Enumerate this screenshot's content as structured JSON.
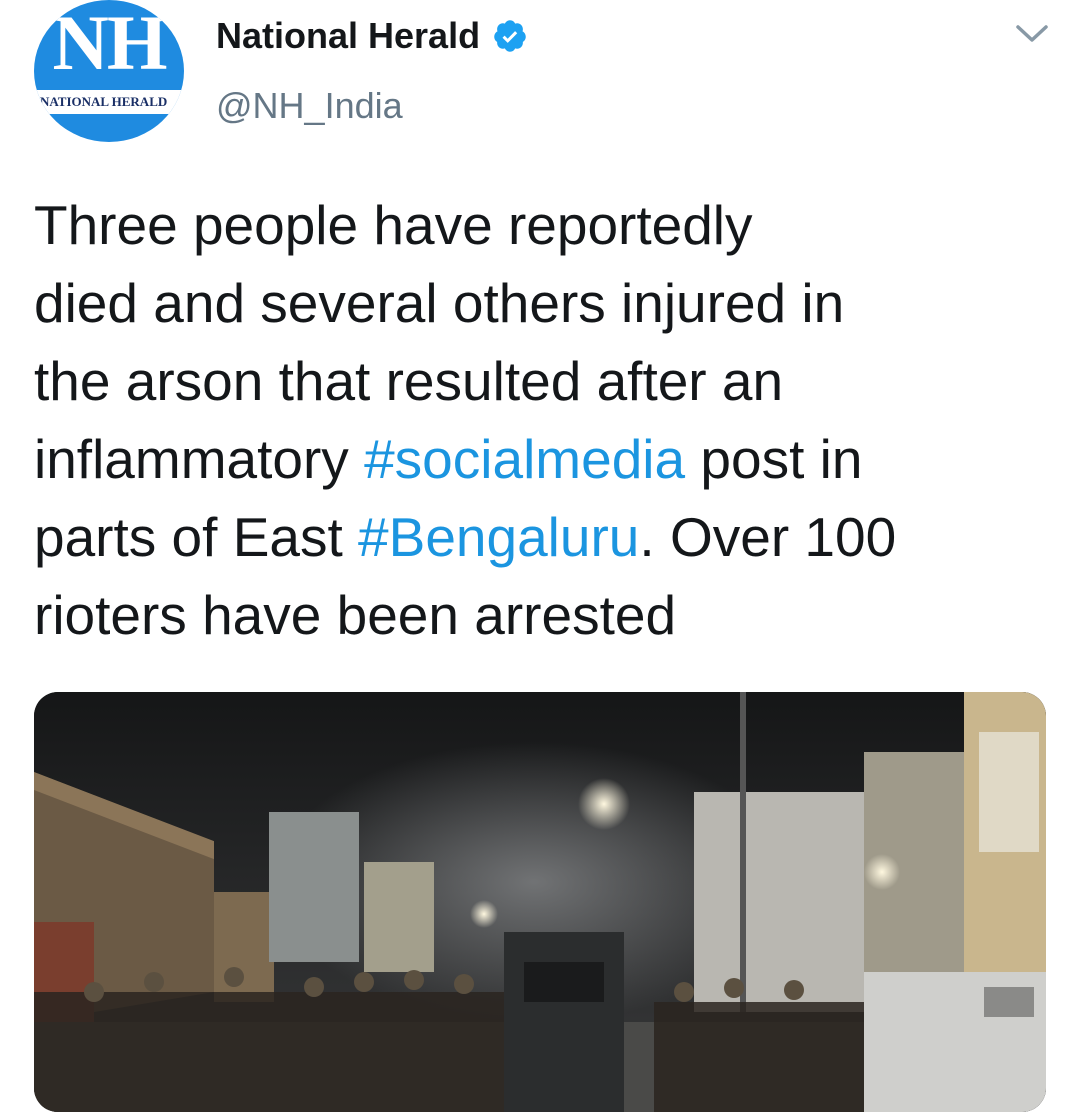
{
  "account": {
    "display_name": "National Herald",
    "handle": "@NH_India",
    "avatar_letters": "NH",
    "avatar_strip_text": "NATIONAL HERALD"
  },
  "tweet": {
    "lines": [
      [
        {
          "t": "Three people have reportedly"
        }
      ],
      [
        {
          "t": "died and several others injured in"
        }
      ],
      [
        {
          "t": "the arson that resulted after an"
        }
      ],
      [
        {
          "t": "inflammatory "
        },
        {
          "t": "#socialmedia",
          "tag": true
        },
        {
          "t": " post in"
        }
      ],
      [
        {
          "t": "parts of East "
        },
        {
          "t": "#Bengaluru",
          "tag": true
        },
        {
          "t": ". Over 100"
        }
      ],
      [
        {
          "t": "rioters have been arrested"
        }
      ]
    ]
  },
  "icons": {
    "verified": "verified-badge-icon",
    "caret": "chevron-down-icon"
  },
  "colors": {
    "link": "#1b95e0",
    "verified": "#1da1f2",
    "avatar_bg": "#1f8be0",
    "handle_gray": "#657786"
  }
}
